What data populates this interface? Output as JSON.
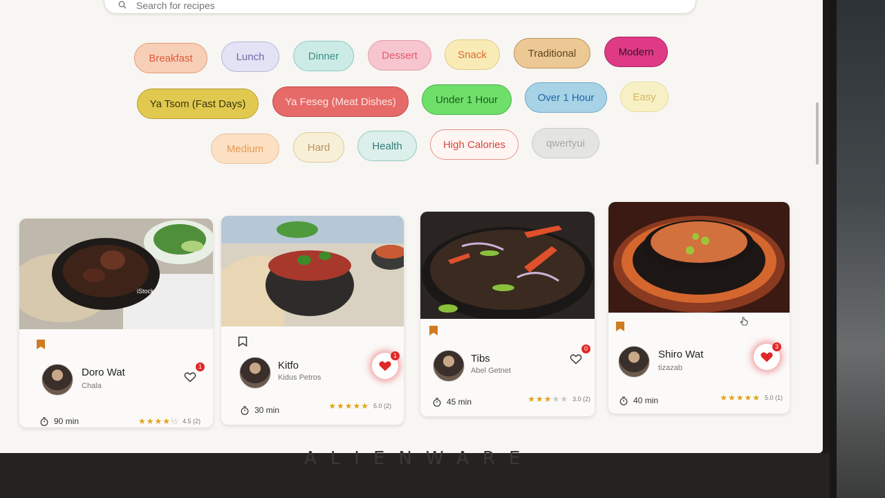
{
  "search": {
    "placeholder": "Search for recipes"
  },
  "categories": [
    {
      "label": "Breakfast",
      "color": "#e2593a",
      "bg": "#f7cfb7",
      "border": "#e59a78"
    },
    {
      "label": "Lunch",
      "color": "#6a6aa8",
      "bg": "#e3e3f5",
      "border": "#b5b5d8"
    },
    {
      "label": "Dinner",
      "color": "#3c8c86",
      "bg": "#cdebe6",
      "border": "#8dc8c0"
    },
    {
      "label": "Dessert",
      "color": "#e35a74",
      "bg": "#f6c5cd",
      "border": "#e59aa8"
    },
    {
      "label": "Snack",
      "color": "#e0682f",
      "bg": "#f8ebb6",
      "border": "#e5c880"
    },
    {
      "label": "Traditional",
      "color": "#5e4520",
      "bg": "#ecc895",
      "border": "#b8915a"
    },
    {
      "label": "Modern",
      "color": "#3a1025",
      "bg": "#de3a86",
      "border": "#a8245f"
    },
    {
      "label": "Ya Tsom (Fast Days)",
      "color": "#3a3412",
      "bg": "#e0c94e",
      "border": "#b89f2e"
    },
    {
      "label": "Ya Feseg (Meat Dishes)",
      "color": "#ffe5e2",
      "bg": "#e56a68",
      "border": "#c04848"
    },
    {
      "label": "Under 1 Hour",
      "color": "#1f5a1f",
      "bg": "#6ee06a",
      "border": "#44b045"
    },
    {
      "label": "Over 1 Hour",
      "color": "#2268a8",
      "bg": "#a8d2e6",
      "border": "#6ea8c8"
    },
    {
      "label": "Easy",
      "color": "#d4b865",
      "bg": "#f7f0c4",
      "border": "#e8dca0"
    },
    {
      "label": "Medium",
      "color": "#e89a50",
      "bg": "#fbe0c4",
      "border": "#eec098"
    },
    {
      "label": "Hard",
      "color": "#b89060",
      "bg": "#f8f0d6",
      "border": "#ddc89a"
    },
    {
      "label": "Health",
      "color": "#2f7a78",
      "bg": "#dcefeb",
      "border": "#98c8c0"
    },
    {
      "label": "High Calories",
      "color": "#d8443c",
      "bg": "#fff6f4",
      "border": "#e8938c"
    },
    {
      "label": "qwertyui",
      "color": "#a8a8a8",
      "bg": "#e4e4e2",
      "border": "#cacac8"
    }
  ],
  "recipes": [
    {
      "name": "Doro Wat",
      "author": "Chala",
      "likes": "1",
      "liked": false,
      "bookmarked": true,
      "time": "90 min",
      "stars": "★★★★",
      "stars_off": "½",
      "rating": "4.5 (2)",
      "watermark": "iStock"
    },
    {
      "name": "Kitfo",
      "author": "Kidus Petros",
      "likes": "1",
      "liked": true,
      "bookmarked": false,
      "time": "30 min",
      "stars": "★★★★★",
      "stars_off": "",
      "rating": "5.0 (2)"
    },
    {
      "name": "Tibs",
      "author": "Abel Getnet",
      "likes": "0",
      "liked": false,
      "bookmarked": true,
      "time": "45 min",
      "stars": "★★★",
      "stars_off": "★★",
      "rating": "3.0 (2)"
    },
    {
      "name": "Shiro Wat",
      "author": "tizazab",
      "likes": "3",
      "liked": true,
      "bookmarked": true,
      "time": "40 min",
      "stars": "★★★★★",
      "stars_off": "",
      "rating": "5.0 (1)"
    }
  ],
  "device": {
    "brand": "ALIENWARE"
  },
  "colors": {
    "bookmark": "#d07a22",
    "heart": "#e02828",
    "star": "#e4a11b"
  }
}
